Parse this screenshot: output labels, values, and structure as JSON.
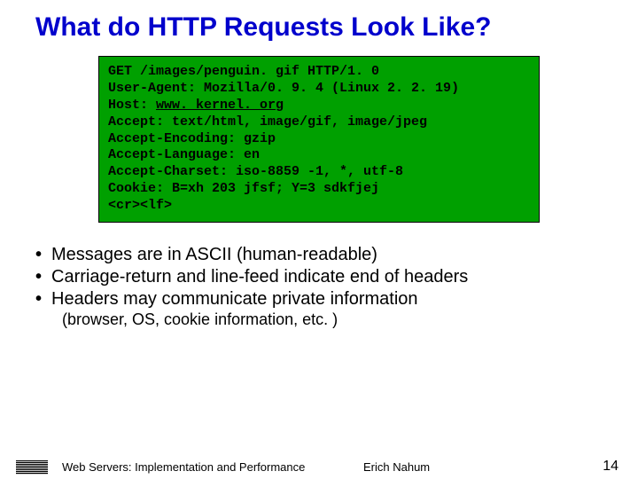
{
  "title": "What do HTTP Requests Look Like?",
  "code": {
    "l1": "GET /images/penguin. gif HTTP/1. 0",
    "l2": "User-Agent: Mozilla/0. 9. 4 (Linux 2. 2. 19)",
    "l3a": "Host: ",
    "l3b": "www. kernel. org",
    "l4": "Accept: text/html, image/gif, image/jpeg",
    "l5": "Accept-Encoding: gzip",
    "l6": "Accept-Language: en",
    "l7": "Accept-Charset: iso-8859 -1, *, utf-8",
    "l8": "Cookie: B=xh 203 jfsf; Y=3 sdkfjej",
    "l9": "<cr><lf>"
  },
  "bullets": {
    "b1": "Messages are in ASCII (human-readable)",
    "b2": "Carriage-return and line-feed indicate end of headers",
    "b3": "Headers may communicate private information",
    "sub": "(browser, OS, cookie information, etc. )"
  },
  "footer": {
    "course": "Web Servers: Implementation and Performance",
    "author": "Erich Nahum",
    "page": "14"
  }
}
